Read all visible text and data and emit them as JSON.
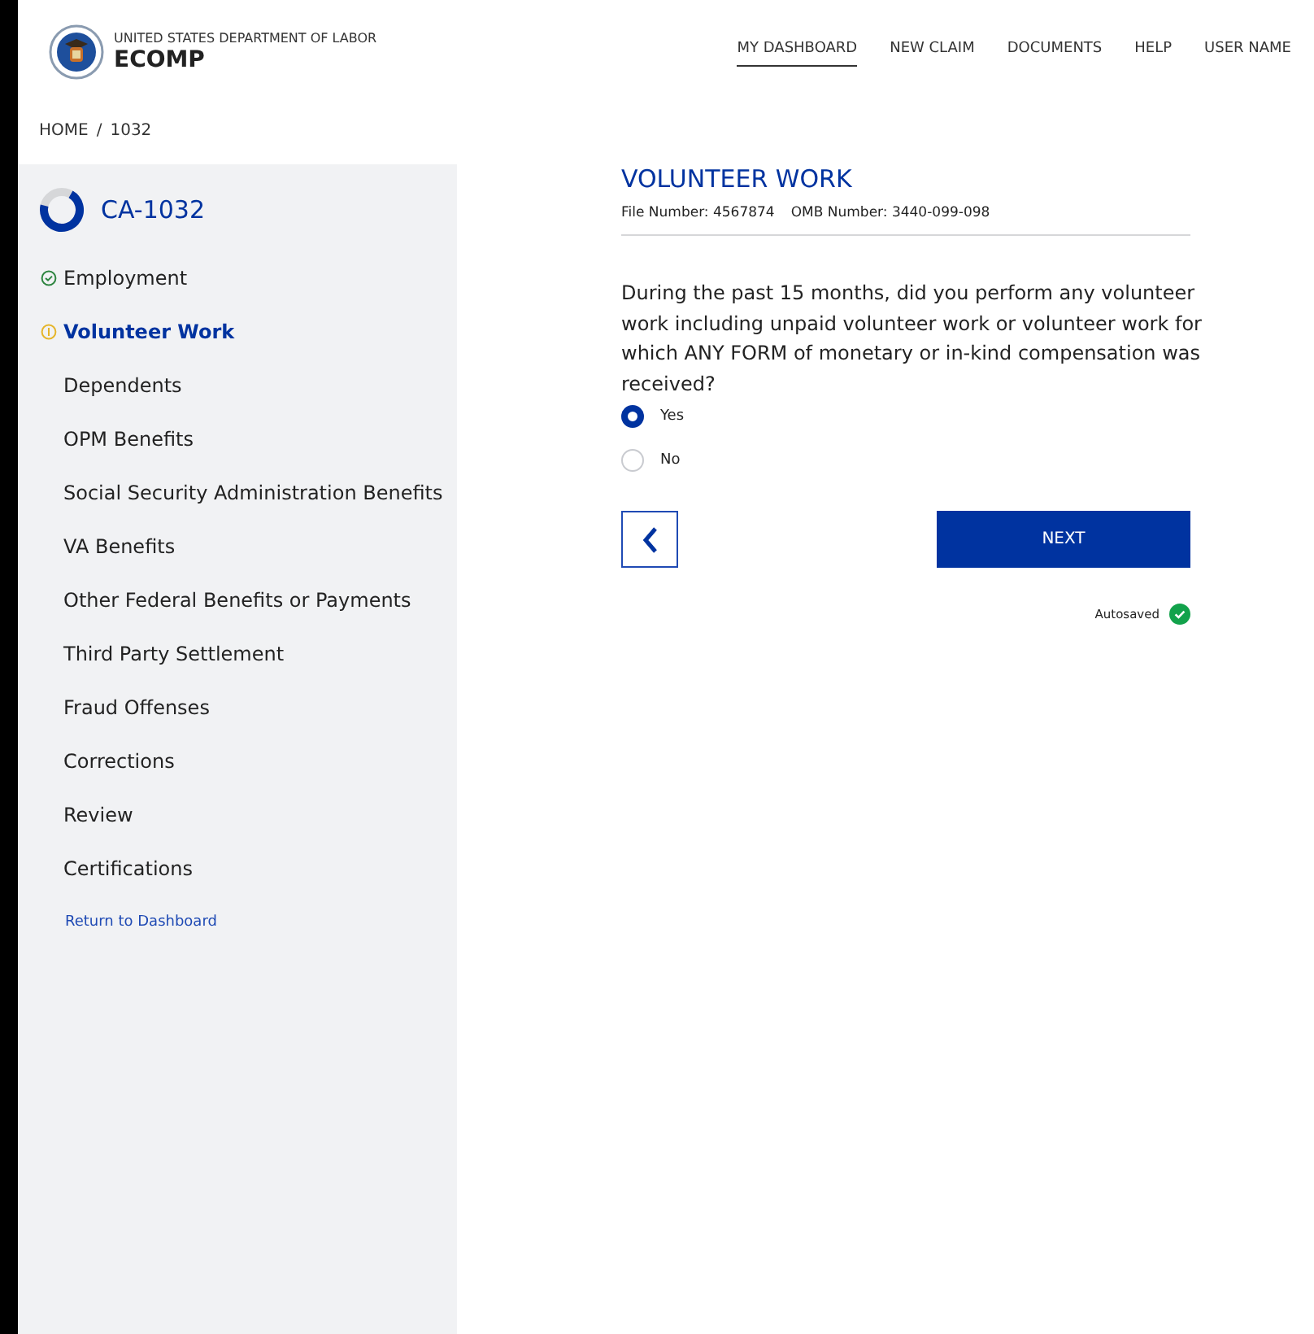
{
  "header": {
    "agency": "UNITED STATES DEPARTMENT OF LABOR",
    "app_name": "ECOMP"
  },
  "nav": [
    {
      "label": "MY DASHBOARD",
      "selected": true
    },
    {
      "label": "NEW CLAIM",
      "selected": false
    },
    {
      "label": "DOCUMENTS",
      "selected": false
    },
    {
      "label": "HELP",
      "selected": false
    },
    {
      "label": "USER NAME",
      "selected": false
    }
  ],
  "breadcrumb": {
    "items": [
      "HOME",
      "1032"
    ],
    "separator": "/"
  },
  "sidebar": {
    "form_title": "CA-1032",
    "progress": {
      "level": 0.7
    },
    "items": [
      {
        "label": "Employment",
        "kind": "complete",
        "selected": false
      },
      {
        "label": "Volunteer Work",
        "kind": "started",
        "selected": true
      },
      {
        "label": "Dependents",
        "kind": "plain",
        "selected": false
      },
      {
        "label": "OPM Benefits",
        "kind": "plain",
        "selected": false
      },
      {
        "label": "Social Security Administration Benefits",
        "kind": "plain",
        "selected": false
      },
      {
        "label": "VA Benefits",
        "kind": "plain",
        "selected": false
      },
      {
        "label": "Other Federal Benefits or Payments",
        "kind": "plain",
        "selected": false
      },
      {
        "label": "Third Party Settlement",
        "kind": "plain",
        "selected": false
      },
      {
        "label": "Fraud Offenses",
        "kind": "plain",
        "selected": false
      },
      {
        "label": "Corrections",
        "kind": "plain",
        "selected": false
      },
      {
        "label": "Review",
        "kind": "plain",
        "selected": false
      },
      {
        "label": "Certifications",
        "kind": "plain",
        "selected": false
      }
    ],
    "return_link": "Return to Dashboard"
  },
  "main": {
    "title": "VOLUNTEER WORK",
    "file_number": "File Number: 4567874",
    "omb_number": "OMB Number: 3440-099-098",
    "question": "During the past 15 months, did you perform any volunteer work including unpaid volunteer work or volunteer work for which ANY FORM of monetary or in-kind compensation was received?",
    "options": [
      {
        "label": "Yes",
        "selected": true
      },
      {
        "label": "No",
        "selected": false
      }
    ],
    "next_button": "NEXT",
    "autosave": "Autosaved"
  }
}
